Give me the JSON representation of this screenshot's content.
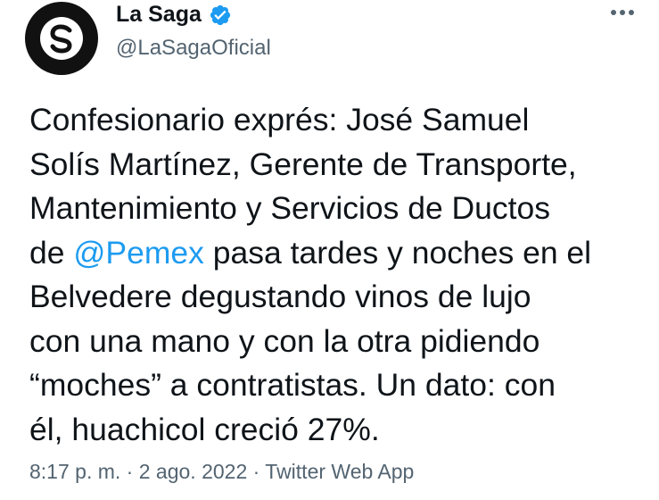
{
  "author": {
    "display_name": "La Saga",
    "handle": "@LaSagaOficial",
    "verified": true
  },
  "tweet": {
    "lines": [
      [
        "Confesionario exprés: José Samuel"
      ],
      [
        "Solís Martínez, Gerente de Transporte,"
      ],
      [
        "Mantenimiento y Servicios de Ductos"
      ],
      [
        "de ",
        "@Pemex",
        " pasa tardes y noches en el"
      ],
      [
        "Belvedere degustando vinos de lujo"
      ],
      [
        "con una mano y con la otra pidiendo"
      ],
      [
        "“moches” a contratistas. Un dato: con"
      ],
      [
        "él, huachicol creció 27%."
      ]
    ],
    "mention": "@Pemex"
  },
  "meta": {
    "time": "8:17 p. m.",
    "separator": "·",
    "date": "2 ago. 2022",
    "source": "Twitter Web App"
  },
  "colors": {
    "accent": "#1d9bf0",
    "secondary_text": "#536471",
    "primary_text": "#0f1419",
    "avatar_bg": "#111111"
  },
  "icons": {
    "avatar": "la-saga-logo-icon",
    "verified": "verified-badge-icon",
    "more": "more-options-icon"
  }
}
